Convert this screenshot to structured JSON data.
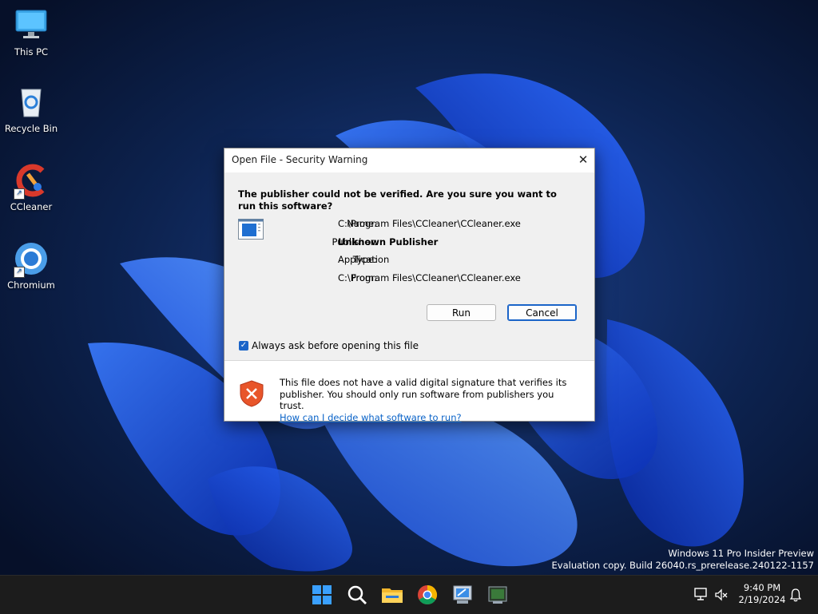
{
  "desktop": {
    "icons": [
      {
        "label": "This PC",
        "icon": "monitor-icon"
      },
      {
        "label": "Recycle Bin",
        "icon": "recycle-bin-icon"
      },
      {
        "label": "CCleaner",
        "icon": "ccleaner-icon"
      },
      {
        "label": "Chromium",
        "icon": "chromium-icon"
      }
    ]
  },
  "dialog": {
    "title": "Open File - Security Warning",
    "close_glyph": "✕",
    "question": "The publisher could not be verified.  Are you sure you want to run this software?",
    "fields": [
      {
        "label": "Name:",
        "value": "C:\\Program Files\\CCleaner\\CCleaner.exe"
      },
      {
        "label": "Publisher:",
        "value": "Unknown Publisher"
      },
      {
        "label": "Type:",
        "value": "Application"
      },
      {
        "label": "From:",
        "value": "C:\\Program Files\\CCleaner\\CCleaner.exe"
      }
    ],
    "buttons": {
      "run": "Run",
      "cancel": "Cancel"
    },
    "always_ask": {
      "label": "Always ask before opening this file",
      "checked": true
    },
    "footer": {
      "text": "This file does not have a valid digital signature that verifies its publisher.  You should only run software from publishers you trust.",
      "link": "How can I decide what software to run?"
    }
  },
  "watermark": {
    "line1": "Windows 11 Pro Insider Preview",
    "line2": "Evaluation copy. Build 26040.rs_prerelease.240122-1157"
  },
  "taskbar": {
    "apps": [
      "start-icon",
      "search-icon",
      "file-explorer-icon",
      "chrome-icon",
      "control-panel-icon",
      "terminal-icon"
    ],
    "time": "9:40 PM",
    "date": "2/19/2024"
  },
  "colors": {
    "accent": "#1a64c8",
    "link": "#0a63c8",
    "taskbar": "#1c1c1c",
    "shield": "#e8552a"
  }
}
